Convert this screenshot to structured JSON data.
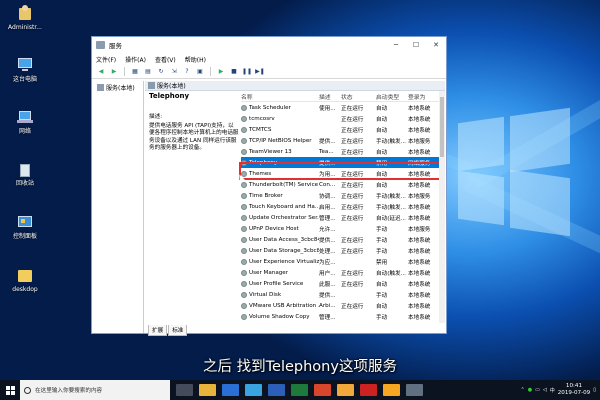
{
  "desktop": {
    "icons": [
      {
        "label": "Administr...",
        "icon": "user-folder-icon"
      },
      {
        "label": "这台电脑",
        "icon": "computer-icon"
      },
      {
        "label": "网络",
        "icon": "network-icon"
      },
      {
        "label": "回收站",
        "icon": "recycle-bin-icon"
      },
      {
        "label": "控制面板",
        "icon": "control-panel-icon"
      },
      {
        "label": "deskdop",
        "icon": "folder-icon"
      }
    ]
  },
  "window": {
    "title": "服务",
    "menu": [
      "文件(F)",
      "操作(A)",
      "查看(V)",
      "帮助(H)"
    ],
    "left_tree_item": "服务(本地)",
    "pane_header": "服务(本地)",
    "selected_service": {
      "name": "Telephony",
      "desc_label": "描述:",
      "description": "提供电话服务 API (TAPI)支持，以便各程序控制本地计算机上的电话服务设备以及通过 LAN 同样运行该服务的服务器上的设备。"
    },
    "columns": [
      "名称",
      "描述",
      "状态",
      "启动类型",
      "登录为"
    ],
    "rows": [
      {
        "name": "Task Scheduler",
        "desc": "使用...",
        "status": "正在运行",
        "startup": "自动",
        "logon": "本地系统"
      },
      {
        "name": "tcmcosrv",
        "desc": "",
        "status": "正在运行",
        "startup": "自动",
        "logon": "本地系统"
      },
      {
        "name": "TCMTCS",
        "desc": "",
        "status": "正在运行",
        "startup": "自动",
        "logon": "本地系统"
      },
      {
        "name": "TCP/IP NetBIOS Helper",
        "desc": "提供...",
        "status": "正在运行",
        "startup": "手动(触发...",
        "logon": "本地服务"
      },
      {
        "name": "TeamViewer 13",
        "desc": "Tea...",
        "status": "正在运行",
        "startup": "自动",
        "logon": "本地系统"
      },
      {
        "name": "Telephony",
        "desc": "提供...",
        "status": "",
        "startup": "禁用",
        "logon": "网络服务"
      },
      {
        "name": "Themes",
        "desc": "为用...",
        "status": "正在运行",
        "startup": "自动",
        "logon": "本地系统"
      },
      {
        "name": "Thunderbolt(TM) Service",
        "desc": "Con...",
        "status": "正在运行",
        "startup": "自动",
        "logon": "本地系统"
      },
      {
        "name": "Time Broker",
        "desc": "协调...",
        "status": "正在运行",
        "startup": "手动(触发...",
        "logon": "本地服务"
      },
      {
        "name": "Touch Keyboard and Ha...",
        "desc": "启用...",
        "status": "正在运行",
        "startup": "手动(触发...",
        "logon": "本地系统"
      },
      {
        "name": "Update Orchestrator Ser...",
        "desc": "管理...",
        "status": "正在运行",
        "startup": "自动(延迟...",
        "logon": "本地系统"
      },
      {
        "name": "UPnP Device Host",
        "desc": "允许...",
        "status": "",
        "startup": "手动",
        "logon": "本地服务"
      },
      {
        "name": "User Data Access_3cbc848",
        "desc": "提供...",
        "status": "正在运行",
        "startup": "手动",
        "logon": "本地系统"
      },
      {
        "name": "User Data Storage_3cbc8...",
        "desc": "处理...",
        "status": "正在运行",
        "startup": "手动",
        "logon": "本地系统"
      },
      {
        "name": "User Experience Virtualiz...",
        "desc": "为应...",
        "status": "",
        "startup": "禁用",
        "logon": "本地系统"
      },
      {
        "name": "User Manager",
        "desc": "用户...",
        "status": "正在运行",
        "startup": "自动(触发...",
        "logon": "本地系统"
      },
      {
        "name": "User Profile Service",
        "desc": "此服...",
        "status": "正在运行",
        "startup": "自动",
        "logon": "本地系统"
      },
      {
        "name": "Virtual Disk",
        "desc": "提供...",
        "status": "",
        "startup": "手动",
        "logon": "本地系统"
      },
      {
        "name": "VMware USB Arbitration ...",
        "desc": "Arbi...",
        "status": "正在运行",
        "startup": "自动",
        "logon": "本地系统"
      },
      {
        "name": "Volume Shadow Copy",
        "desc": "管理...",
        "status": "",
        "startup": "手动",
        "logon": "本地系统"
      }
    ],
    "bottom_tabs": [
      "扩展",
      "标准"
    ]
  },
  "caption": "之后 找到Telephony这项服务",
  "taskbar": {
    "search_placeholder": "在这里输入你要搜索的内容",
    "time": "10:41",
    "date": "2019-07-09",
    "lang": "中"
  },
  "colors": {
    "selection": "#0078d7",
    "highlight_box": "#e03131",
    "taskbar": "#0c1320"
  }
}
